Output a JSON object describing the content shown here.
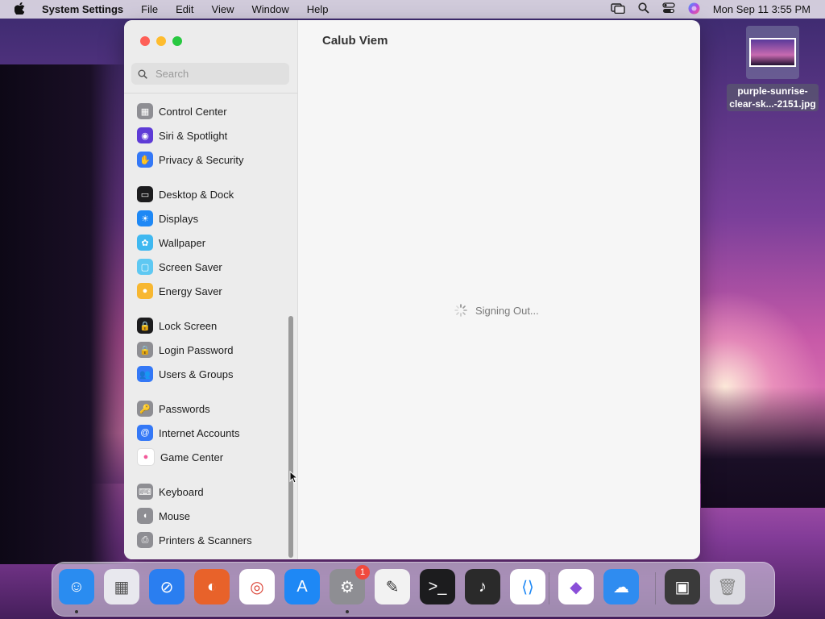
{
  "menubar": {
    "app_name": "System Settings",
    "items": [
      "File",
      "Edit",
      "View",
      "Window",
      "Help"
    ],
    "clock": "Mon Sep 11  3:55 PM"
  },
  "window": {
    "title": "Calub Viem",
    "search_placeholder": "Search",
    "loading_text": "Signing Out...",
    "sidebar": [
      {
        "label": "Control Center",
        "icon": "control-center-icon",
        "color": "#8e8e93"
      },
      {
        "label": "Siri & Spotlight",
        "icon": "siri-icon",
        "color": "#5e3bd6"
      },
      {
        "label": "Privacy & Security",
        "icon": "hand-icon",
        "color": "#3478f6"
      },
      {
        "label": "Desktop & Dock",
        "icon": "dock-icon",
        "color": "#1c1c1e"
      },
      {
        "label": "Displays",
        "icon": "sun-icon",
        "color": "#1e88f5"
      },
      {
        "label": "Wallpaper",
        "icon": "flower-icon",
        "color": "#3fb8f0"
      },
      {
        "label": "Screen Saver",
        "icon": "screensaver-icon",
        "color": "#5ec8f2"
      },
      {
        "label": "Energy Saver",
        "icon": "bulb-icon",
        "color": "#f7b731"
      },
      {
        "label": "Lock Screen",
        "icon": "lock-icon",
        "color": "#1c1c1e"
      },
      {
        "label": "Login Password",
        "icon": "padlock-icon",
        "color": "#8e8e93"
      },
      {
        "label": "Users & Groups",
        "icon": "users-icon",
        "color": "#3478f6"
      },
      {
        "label": "Passwords",
        "icon": "key-icon",
        "color": "#8e8e93"
      },
      {
        "label": "Internet Accounts",
        "icon": "at-icon",
        "color": "#3478f6"
      },
      {
        "label": "Game Center",
        "icon": "game-center-icon",
        "color": "#ffffff"
      },
      {
        "label": "Keyboard",
        "icon": "keyboard-icon",
        "color": "#8e8e93"
      },
      {
        "label": "Mouse",
        "icon": "mouse-icon",
        "color": "#8e8e93"
      },
      {
        "label": "Printers & Scanners",
        "icon": "printer-icon",
        "color": "#8e8e93"
      }
    ]
  },
  "desktop_file": {
    "label_line1": "purple-sunrise-",
    "label_line2": "clear-sk...-2151.jpg"
  },
  "dock": {
    "settings_badge": "1",
    "apps": [
      {
        "name": "finder-icon",
        "color": "#2a8cf0"
      },
      {
        "name": "launchpad-icon",
        "color": "#e8e8ee"
      },
      {
        "name": "safari-icon",
        "color": "#2a7ef0"
      },
      {
        "name": "firefox-icon",
        "color": "#e8622a"
      },
      {
        "name": "chrome-icon",
        "color": "#ffffff"
      },
      {
        "name": "app-store-icon",
        "color": "#1e88f5"
      },
      {
        "name": "system-settings-icon",
        "color": "#8e8e93"
      },
      {
        "name": "textedit-icon",
        "color": "#f2f2f2"
      },
      {
        "name": "terminal-icon",
        "color": "#1c1c1e"
      },
      {
        "name": "garageband-icon",
        "color": "#2a2a2a"
      },
      {
        "name": "vscode-icon",
        "color": "#ffffff"
      },
      {
        "name": "visual-studio-icon",
        "color": "#ffffff"
      },
      {
        "name": "weather-icon",
        "color": "#2f8cf0"
      },
      {
        "name": "chrome-window-icon",
        "color": "#3a3a3a"
      },
      {
        "name": "trash-icon",
        "color": "#dcdce2"
      }
    ]
  }
}
